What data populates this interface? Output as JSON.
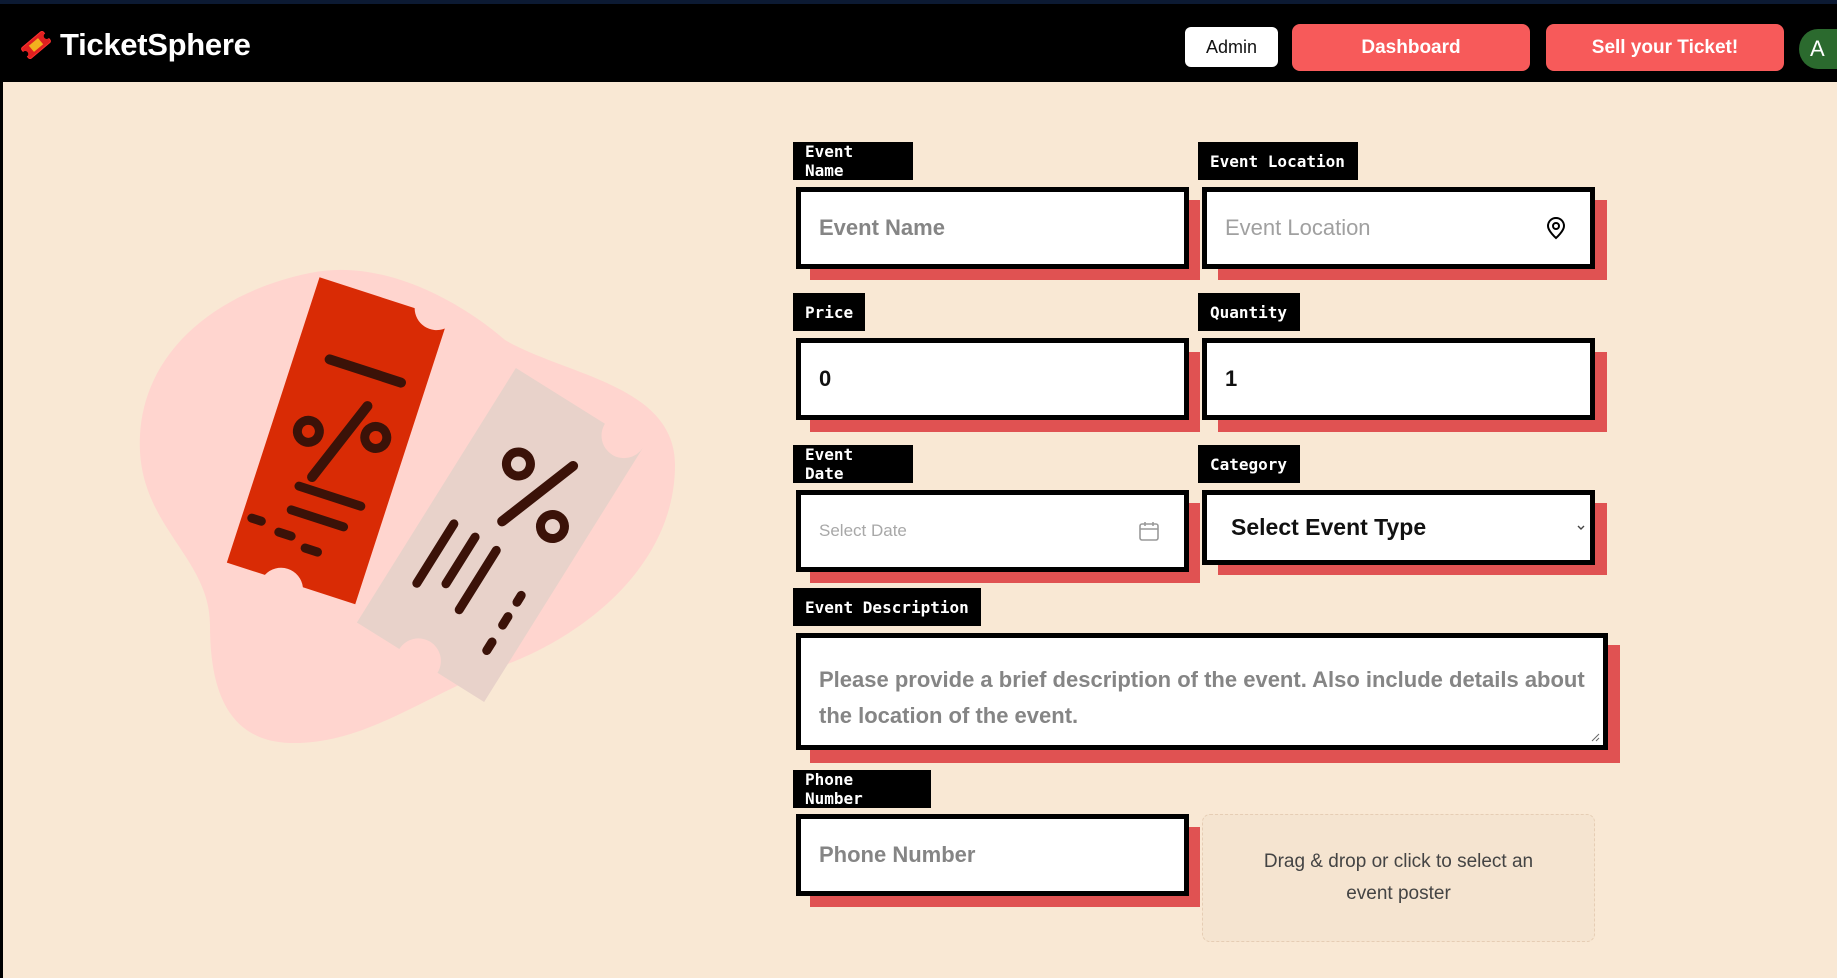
{
  "app": {
    "name": "TicketSphere"
  },
  "nav": {
    "admin_label": "Admin",
    "dashboard_label": "Dashboard",
    "sell_label": "Sell your Ticket!",
    "avatar_initial": "A"
  },
  "form": {
    "event_name": {
      "label": "Event Name",
      "placeholder": "Event Name"
    },
    "event_location": {
      "label": "Event Location",
      "placeholder": "Event Location"
    },
    "price": {
      "label": "Price",
      "value": "0"
    },
    "quantity": {
      "label": "Quantity",
      "value": "1"
    },
    "event_date": {
      "label": "Event Date",
      "placeholder": "Select Date"
    },
    "category": {
      "label": "Category",
      "selected": "Select Event Type"
    },
    "event_description": {
      "label": "Event Description",
      "placeholder": "Please provide a brief description of the event. Also include details about the location of the event."
    },
    "phone_number": {
      "label": "Phone Number",
      "placeholder": "Phone Number"
    },
    "poster_dropzone": {
      "text": "Drag & drop or click to select an event poster"
    }
  },
  "colors": {
    "background": "#f9e8d4",
    "navbar": "#000000",
    "accent": "#f75a5a",
    "field_shadow": "#e05252",
    "avatar": "#2b6a2e"
  },
  "icons": [
    "ticket-logo-icon",
    "location-pin-icon",
    "calendar-icon",
    "chevron-down-icon",
    "resize-handle-icon"
  ]
}
